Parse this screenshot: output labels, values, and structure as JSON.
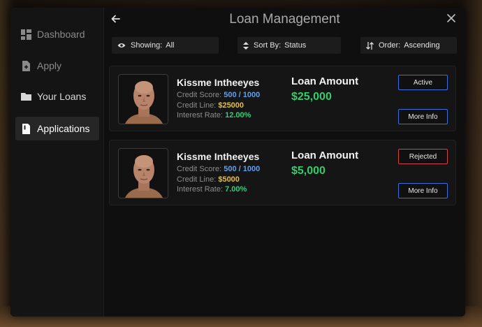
{
  "header": {
    "title": "Loan Management"
  },
  "sidebar": {
    "items": [
      {
        "label": "Dashboard",
        "icon": "dashboard-icon"
      },
      {
        "label": "Apply",
        "icon": "file-plus-icon"
      },
      {
        "label": "Your Loans",
        "icon": "folder-icon"
      },
      {
        "label": "Applications",
        "icon": "document-icon",
        "active": true
      }
    ]
  },
  "filters": {
    "showing": {
      "label": "Showing:",
      "value": "All",
      "icon": "eye-icon"
    },
    "sort": {
      "label": "Sort By:",
      "value": "Status",
      "icon": "sort-icon"
    },
    "order": {
      "label": "Order:",
      "value": "Ascending",
      "icon": "order-icon"
    }
  },
  "loans": [
    {
      "name": "Kissme Intheeyes",
      "credit_score_label": "Credit Score:",
      "credit_score": "500 / 1000",
      "credit_line_label": "Credit Line:",
      "credit_line": "$25000",
      "interest_label": "Interest Rate:",
      "interest_rate": "12.00%",
      "amount_label": "Loan Amount",
      "amount": "$25,000",
      "status": "Active",
      "more_info": "More Info"
    },
    {
      "name": "Kissme Intheeyes",
      "credit_score_label": "Credit Score:",
      "credit_score": "500 / 1000",
      "credit_line_label": "Credit Line:",
      "credit_line": "$5000",
      "interest_label": "Interest Rate:",
      "interest_rate": "7.00%",
      "amount_label": "Loan Amount",
      "amount": "$5,000",
      "status": "Rejected",
      "more_info": "More Info"
    }
  ],
  "colors": {
    "accent_blue": "#3a6fe0",
    "rejected_red": "#d14545",
    "amount_green": "#2fcf6b",
    "credit_line_yellow": "#f0bf2a"
  }
}
